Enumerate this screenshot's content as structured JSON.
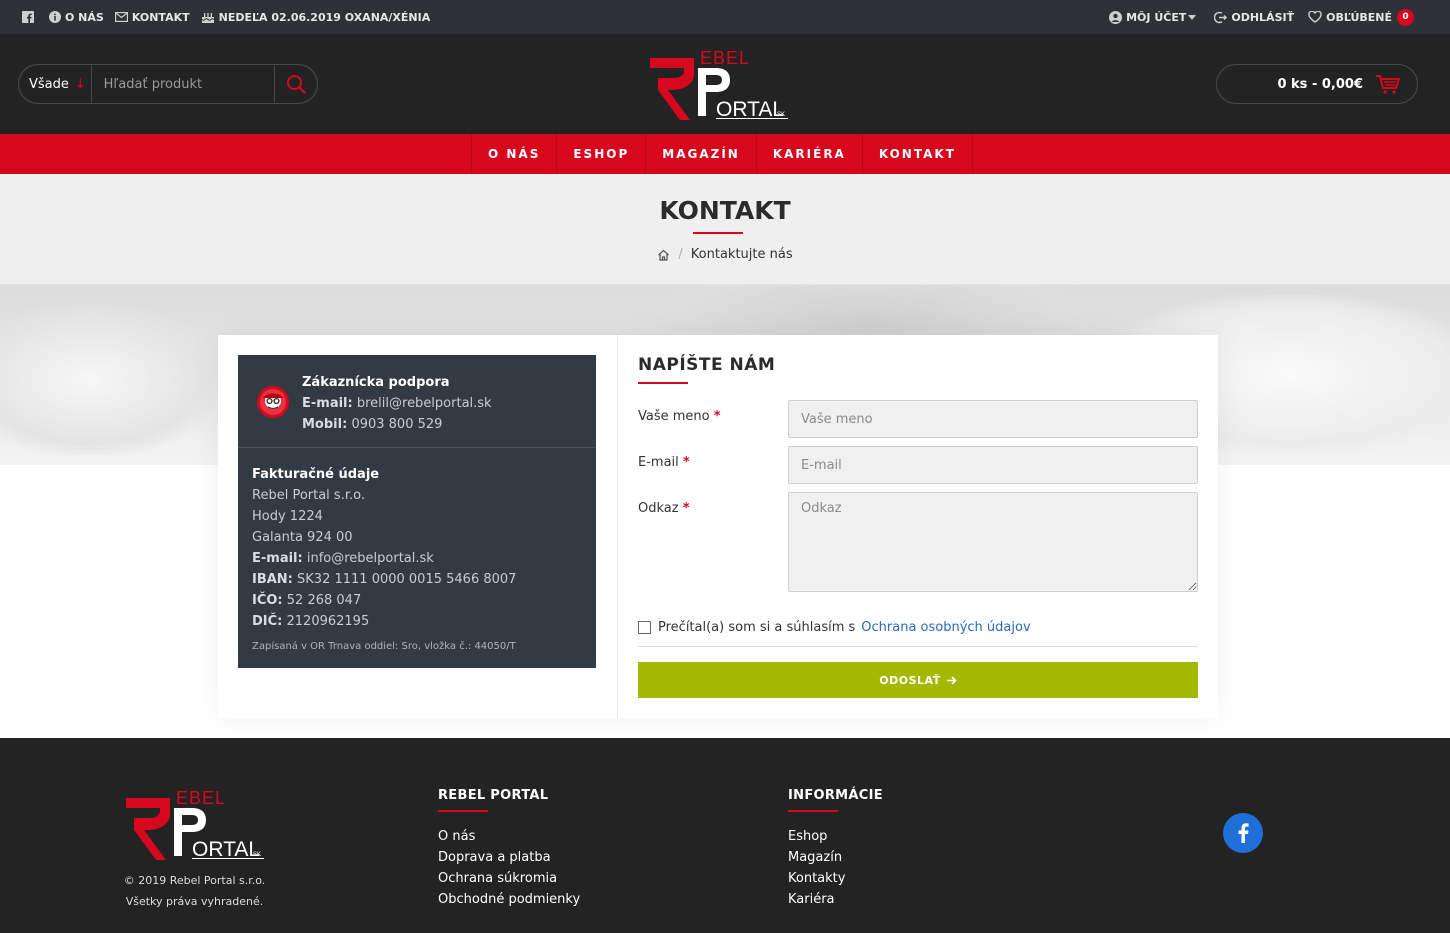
{
  "topbar": {
    "about": "O NÁS",
    "contact": "KONTAKT",
    "nameday": "NEDEĽA 02.06.2019 OXANA/XÉNIA",
    "account": "MÔJ ÚČET",
    "logout": "ODHLÁSIŤ",
    "favorites": "OBĽÚBENÉ",
    "favorites_count": "0"
  },
  "header": {
    "search_scope": "Všade",
    "search_placeholder": "Hľadať produkt",
    "cart_summary": "0 ks - 0,00€"
  },
  "nav": [
    "O NÁS",
    "ESHOP",
    "MAGAZÍN",
    "KARIÉRA",
    "KONTAKT"
  ],
  "page": {
    "title": "KONTAKT",
    "breadcrumb": "Kontaktujte nás"
  },
  "support": {
    "heading": "Zákaznícka podpora",
    "email_label": "E-mail:",
    "email": "brelil@rebelportal.sk",
    "mobile_label": "Mobil:",
    "mobile": "0903 800 529"
  },
  "billing": {
    "heading": "Fakturačné údaje",
    "company": "Rebel Portal s.r.o.",
    "street": "Hody 1224",
    "city": "Galanta 924 00",
    "email_label": "E-mail:",
    "email": "info@rebelportal.sk",
    "iban_label": "IBAN:",
    "iban": "SK32 1111 0000 0015 5466 8007",
    "ico_label": "IČO:",
    "ico": "52 268 047",
    "dic_label": "DIČ:",
    "dic": "2120962195",
    "register": "Zapísaná v OR Trnava oddiel: Sro, vložka č.: 44050/T"
  },
  "form": {
    "heading": "NAPÍŠTE NÁM",
    "name_label": "Vaše meno",
    "name_placeholder": "Vaše meno",
    "email_label": "E-mail",
    "email_placeholder": "E-mail",
    "message_label": "Odkaz",
    "message_placeholder": "Odkaz",
    "required_mark": "*",
    "consent_text": "Prečítal(a) som si a súhlasím s",
    "consent_link": "Ochrana osobných údajov",
    "submit": "ODOSLAŤ"
  },
  "footer": {
    "copyright": "© 2019 Rebel Portal s.r.o.",
    "rights": "Všetky práva vyhradené.",
    "col1_title": "REBEL PORTAL",
    "col1_links": [
      "O nás",
      "Doprava a platba",
      "Ochrana súkromia",
      "Obchodné podmienky"
    ],
    "col2_title": "INFORMÁCIE",
    "col2_links": [
      "Eshop",
      "Magazín",
      "Kontakty",
      "Kariéra"
    ]
  },
  "brand": {
    "logo_top": "EBEL",
    "logo_bottom": "ORTAL",
    "logo_suffix": "SK"
  },
  "colors": {
    "accent_red": "#d7071e",
    "submit_green": "#a3b800",
    "facebook_blue": "#1f6fd8"
  }
}
